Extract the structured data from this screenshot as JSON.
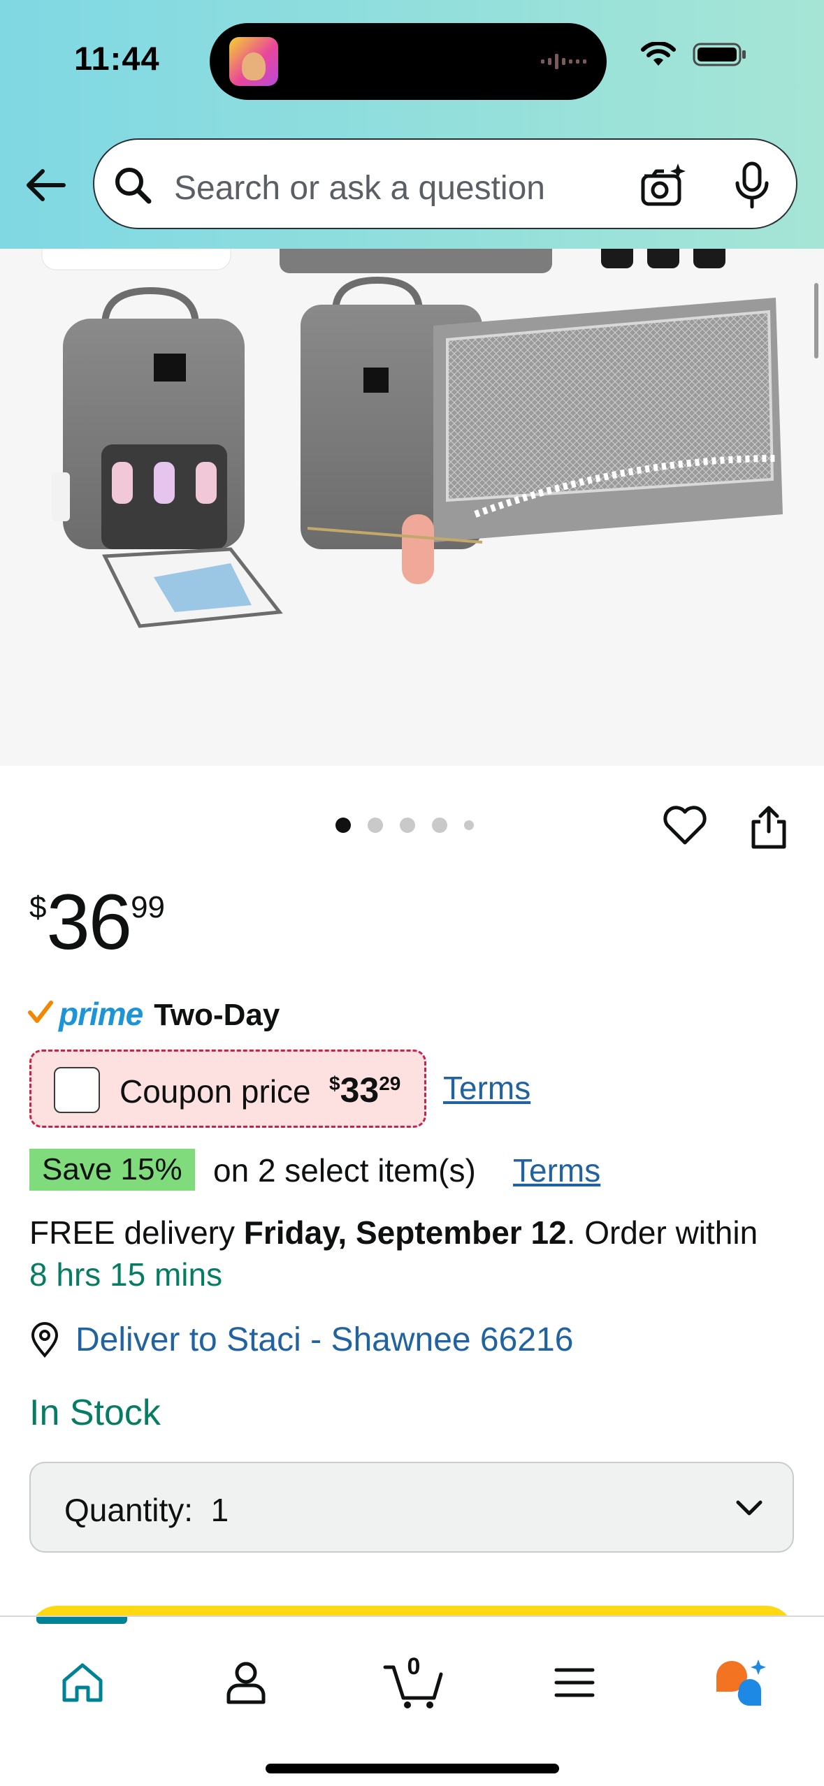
{
  "status_bar": {
    "time": "11:44"
  },
  "search": {
    "placeholder": "Search or ask a question"
  },
  "product": {
    "image_alt": "Gray diaper bag backpack with foldable bassinet",
    "carousel": {
      "total_dots": 5,
      "active_index": 0
    },
    "price": {
      "symbol": "$",
      "whole": "36",
      "fraction": "99"
    },
    "prime": {
      "word": "prime",
      "label": "Two-Day"
    },
    "coupon": {
      "label": "Coupon price",
      "symbol": "$",
      "whole": "33",
      "fraction": "29",
      "terms": "Terms"
    },
    "save": {
      "badge": "Save 15%",
      "text": "on 2 select item(s)",
      "terms": "Terms"
    },
    "delivery": {
      "prefix": "FREE delivery ",
      "date": "Friday, September 12",
      "suffix": ". Order within",
      "countdown": "8 hrs 15 mins"
    },
    "deliver_to": "Deliver to Staci - Shawnee 66216",
    "stock": "In Stock",
    "quantity": {
      "label": "Quantity:",
      "value": "1"
    }
  },
  "tabbar": {
    "cart_count": "0",
    "items": [
      "home",
      "account",
      "cart",
      "menu",
      "rufus"
    ]
  },
  "colors": {
    "header_gradient_start": "#80d8e3",
    "header_gradient_end": "#a6e5d5",
    "link": "#2162a1",
    "success": "#067d62",
    "prime_blue": "#1c94d6",
    "coupon_border": "#c7234b",
    "save_badge": "#7fdb7c",
    "tab_accent": "#008296"
  }
}
